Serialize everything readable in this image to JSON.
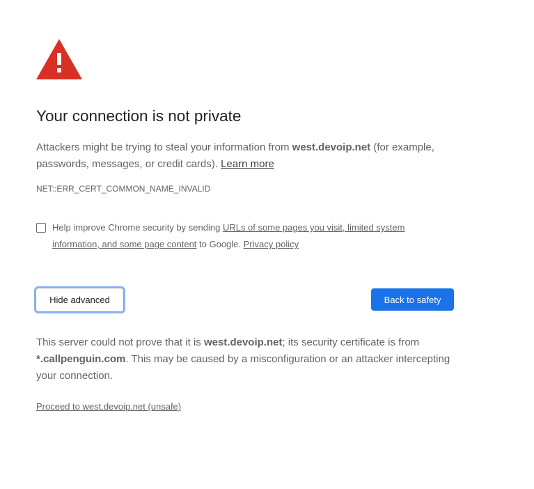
{
  "icon": "warning-triangle-icon",
  "colors": {
    "warning_red": "#d93025",
    "primary_blue": "#1a73e8",
    "text_gray": "#5f6368",
    "focus_ring": "#8ab4f8"
  },
  "heading": "Your connection is not private",
  "intro": {
    "prefix": "Attackers might be trying to steal your information from ",
    "host": "west.devoip.net",
    "suffix": " (for example, passwords, messages, or credit cards). ",
    "learn_more": "Learn more"
  },
  "error_code": "NET::ERR_CERT_COMMON_NAME_INVALID",
  "optin": {
    "checked": false,
    "prefix": "Help improve Chrome security by sending ",
    "link": "URLs of some pages you visit, limited system information, and some page content",
    "middle": " to Google. ",
    "privacy_link": "Privacy policy"
  },
  "buttons": {
    "hide_advanced": "Hide advanced",
    "back_to_safety": "Back to safety"
  },
  "details": {
    "prefix": "This server could not prove that it is ",
    "host": "west.devoip.net",
    "middle": "; its security certificate is from ",
    "cert_host": "*.callpenguin.com",
    "suffix": ". This may be caused by a misconfiguration or an attacker intercepting your connection."
  },
  "proceed_link": "Proceed to west.devoip.net (unsafe)"
}
